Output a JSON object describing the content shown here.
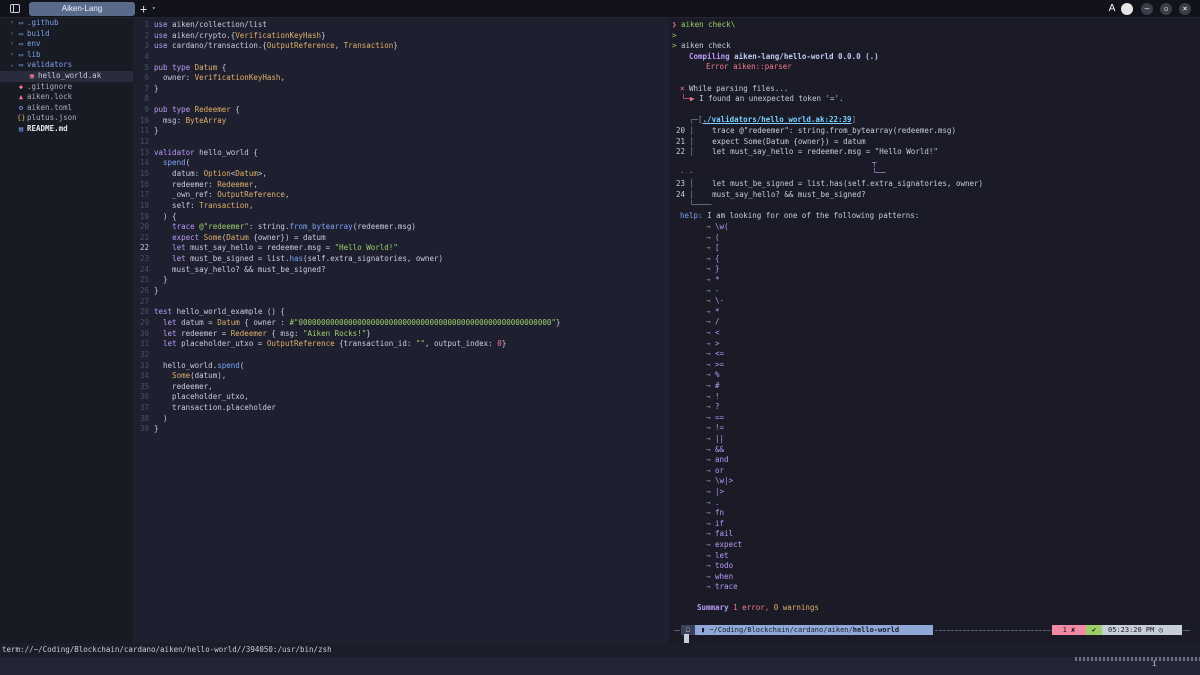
{
  "tab": {
    "title": "Aiken-Lang",
    "new_tab": "+",
    "menu": "▾"
  },
  "window": {
    "app_icon": "A"
  },
  "file_tree": [
    {
      "label": ".github",
      "type": "folder",
      "open": false,
      "depth": 0
    },
    {
      "label": "build",
      "type": "folder",
      "open": false,
      "depth": 0
    },
    {
      "label": "env",
      "type": "folder",
      "open": false,
      "depth": 0
    },
    {
      "label": "lib",
      "type": "folder",
      "open": false,
      "depth": 0
    },
    {
      "label": "validators",
      "type": "folder",
      "open": true,
      "depth": 0
    },
    {
      "label": "hello_world.ak",
      "type": "ak",
      "depth": 1,
      "selected": true
    },
    {
      "label": ".gitignore",
      "type": "git",
      "depth": 0
    },
    {
      "label": "aiken.lock",
      "type": "lock",
      "depth": 0
    },
    {
      "label": "aiken.toml",
      "type": "toml",
      "depth": 0
    },
    {
      "label": "plutus.json",
      "type": "json",
      "depth": 0
    },
    {
      "label": "README.md",
      "type": "md",
      "depth": 0
    }
  ],
  "editor": {
    "current_line": 22,
    "lines": [
      "use aiken/collection/list",
      "use aiken/crypto.{VerificationKeyHash}",
      "use cardano/transaction.{OutputReference, Transaction}",
      "",
      "pub type Datum {",
      "  owner: VerificationKeyHash,",
      "}",
      "",
      "pub type Redeemer {",
      "  msg: ByteArray",
      "}",
      "",
      "validator hello_world {",
      "  spend(",
      "    datum: Option<Datum>,",
      "    redeemer: Redeemer,",
      "    _own_ref: OutputReference,",
      "    self: Transaction,",
      "  ) {",
      "    trace @\"redeemer\": string.from_bytearray(redeemer.msg)",
      "    expect Some(Datum {owner}) = datum",
      "    let must_say_hello = redeemer.msg = \"Hello World!\"",
      "    let must_be_signed = list.has(self.extra_signatories, owner)",
      "    must_say_hello? && must_be_signed?",
      "  }",
      "}",
      "",
      "test hello_world_example () {",
      "  let datum = Datum { owner : #\"00000000000000000000000000000000000000000000000000000000\"}",
      "  let redeemer = Redeemer { msg: \"Aiken Rocks!\"}",
      "  let placeholder_utxo = OutputReference {transaction_id: \"\", output_index: 0}",
      "",
      "  hello_world.spend(",
      "    Some(datum),",
      "    redeemer,",
      "    placeholder_utxo,",
      "    transaction.placeholder",
      "  )",
      "}"
    ]
  },
  "terminal": {
    "prompt_char": "❯",
    "continuation_char": ">",
    "cmd1": "aiken check\\",
    "cmd2": "aiken check",
    "compiling_label": "Compiling",
    "compiling_target": "aiken-lang/hello-world 0.0.0 (.)",
    "error_title": "Error aiken::parser",
    "parse_msg": "While parsing files...",
    "token_msg": "I found an unexpected token '='.",
    "location": "./validators/hello_world.ak:22:39",
    "snippet": [
      {
        "ln": "20",
        "text": "    trace @\"redeemer\": string.from_bytearray(redeemer.msg)"
      },
      {
        "ln": "21",
        "text": "    expect Some(Datum {owner}) = datum"
      },
      {
        "ln": "22",
        "text": "    let must_say_hello = redeemer.msg = \"Hello World!\""
      },
      {
        "ln": "23",
        "text": "    let must_be_signed = list.has(self.extra_signatories, owner)"
      },
      {
        "ln": "24",
        "text": "    must_say_hello? && must_be_signed?"
      }
    ],
    "help_label": "help:",
    "help_text": "I am looking for one of the following patterns:",
    "patterns": [
      "\\w(",
      "(",
      "[",
      "{",
      "}",
      "*",
      "-",
      "\\-",
      "*",
      "/",
      "<",
      ">",
      "<=",
      ">=",
      "%",
      "#",
      "!",
      "?",
      "==",
      "!=",
      "||",
      "&&",
      "and",
      "or",
      "\\w|>",
      "|>",
      ".",
      "fn",
      "if",
      "fail",
      "expect",
      "let",
      "todo",
      "when",
      "trace"
    ],
    "summary_label": "Summary",
    "summary_errors": "1 error,",
    "summary_warnings": "0 warnings",
    "powerline": {
      "path_prefix": "~/Coding/Blockchain/cardano/aiken/",
      "path_leaf": "hello-world",
      "exit_status": "1 ✘",
      "check": "✔",
      "time": "05:23:20 PM"
    }
  },
  "status_line": "term://~/Coding/Blockchain/cardano/aiken/hello-world//394050:/usr/bin/zsh",
  "command_line": {
    "info": "i"
  },
  "colors": {
    "accent": "#7aa2f7",
    "keyword": "#bb9af7",
    "type": "#e0af68",
    "string": "#9ece6a",
    "error": "#f7768e"
  }
}
